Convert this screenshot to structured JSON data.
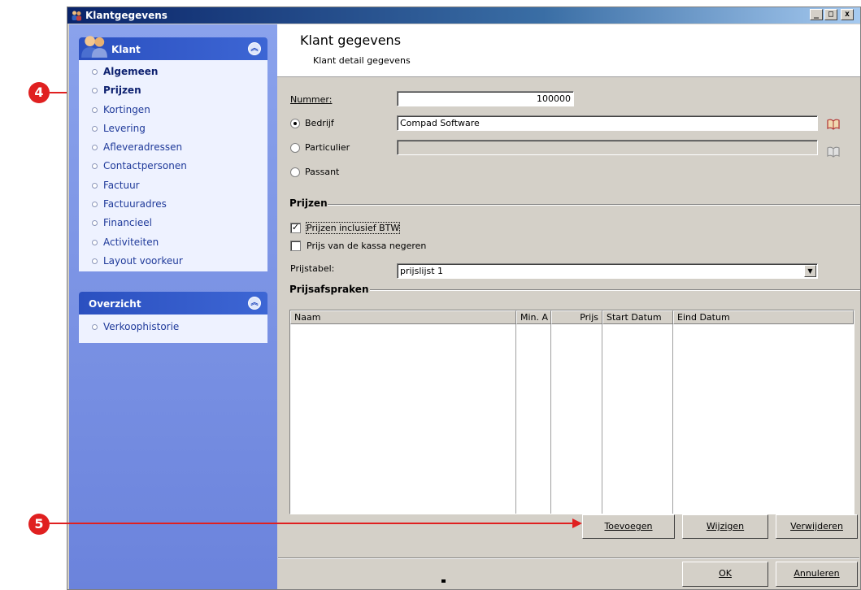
{
  "window": {
    "title": "Klantgegevens",
    "controls": {
      "minimize": "_",
      "maximize": "□",
      "close": "x"
    }
  },
  "sidebar": {
    "klant_panel": {
      "title": "Klant",
      "items": [
        {
          "label": "Algemeen",
          "bold": true
        },
        {
          "label": "Prijzen",
          "bold": true
        },
        {
          "label": "Kortingen"
        },
        {
          "label": "Levering"
        },
        {
          "label": "Afleveradressen"
        },
        {
          "label": "Contactpersonen"
        },
        {
          "label": "Factuur"
        },
        {
          "label": "Factuuradres"
        },
        {
          "label": "Financieel"
        },
        {
          "label": "Activiteiten"
        },
        {
          "label": "Layout voorkeur"
        }
      ]
    },
    "overzicht_panel": {
      "title": "Overzicht",
      "items": [
        {
          "label": "Verkoophistorie"
        }
      ]
    }
  },
  "header": {
    "title": "Klant gegevens",
    "subtitle": "Klant detail gegevens"
  },
  "form": {
    "nummer_label": "Nummer:",
    "nummer_value": "100000",
    "bedrijf_label": "Bedrijf",
    "bedrijf_value": "Compad Software",
    "particulier_label": "Particulier",
    "particulier_value": "",
    "passant_label": "Passant",
    "selected_radio": "Bedrijf"
  },
  "prijzen": {
    "group_title": "Prijzen",
    "incl_btw_label": "Prijzen inclusief BTW",
    "incl_btw_checked": true,
    "kassa_label": "Prijs van de kassa negeren",
    "kassa_checked": false,
    "prijstabel_label": "Prijstabel:",
    "prijstabel_value": "prijslijst 1",
    "dropdown_arrow": "▼"
  },
  "prijsafspraken": {
    "group_title": "Prijsafspraken",
    "columns": [
      "Naam",
      "Min. A",
      "Prijs",
      "Start Datum",
      "Eind Datum"
    ],
    "rows": []
  },
  "buttons": {
    "toevoegen": "Toevoegen",
    "wijzigen": "Wijzigen",
    "verwijderen": "Verwijderen",
    "ok": "OK",
    "annuleren": "Annuleren"
  },
  "annotations": {
    "marker_4": "4",
    "marker_5": "5",
    "arrow_color": "#e02020"
  },
  "colors": {
    "title_bar": "#0a246a",
    "sidebar": "#7b93e4",
    "panel_header": "#2b50c0"
  }
}
